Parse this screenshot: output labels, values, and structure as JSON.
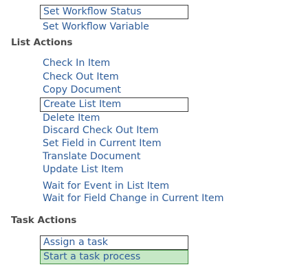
{
  "workflow_items": [
    "Set Workflow Status",
    "Set Workflow Variable"
  ],
  "list_actions": {
    "header": "List Actions",
    "items": [
      "Check In Item",
      "Check Out Item",
      "Copy Document",
      "Create List Item",
      "Delete Item",
      "Discard Check Out Item",
      "Set Field in Current Item",
      "Translate Document",
      "Update List Item",
      "Wait for Event in List Item",
      "Wait for Field Change in Current Item"
    ]
  },
  "task_actions": {
    "header": "Task Actions",
    "items": [
      "Assign a task",
      "Start a task process"
    ]
  },
  "colors": {
    "link": "#2e5d9a",
    "header": "#4a4a4a",
    "selected_bg": "#c6e8c6",
    "selected_border": "#3f8a3f",
    "box_border": "#3a3a3a"
  }
}
